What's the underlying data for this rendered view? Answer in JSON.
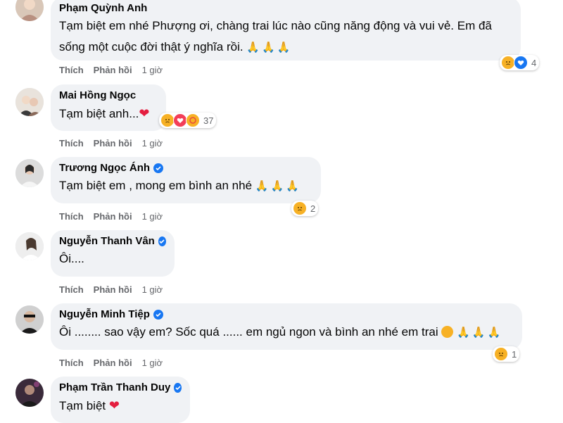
{
  "comments": [
    {
      "name": "Phạm Quỳnh Anh",
      "verified": false,
      "lines": [
        "Tạm biệt em nhé Phượng ơi, chàng trai lúc nào cũng năng động và vui vẻ. Em đã",
        "sống một cuộc đời thật ý nghĩa rồi."
      ],
      "reaction_count": "4",
      "like": "Thích",
      "reply": "Phản hồi",
      "time": "1 giờ"
    },
    {
      "name": "Mai Hồng Ngọc",
      "verified": false,
      "lines": [
        "Tạm biệt anh..."
      ],
      "reaction_count": "37",
      "like": "Thích",
      "reply": "Phản hồi",
      "time": "1 giờ"
    },
    {
      "name": "Trương Ngọc Ánh",
      "verified": true,
      "lines": [
        "Tạm biệt em , mong em bình an nhé"
      ],
      "reaction_count": "2",
      "like": "Thích",
      "reply": "Phản hồi",
      "time": "1 giờ"
    },
    {
      "name": "Nguyễn Thanh Vân",
      "verified": true,
      "lines": [
        "Ôi...."
      ],
      "like": "Thích",
      "reply": "Phản hồi",
      "time": "1 giờ"
    },
    {
      "name": "Nguyễn Minh Tiệp",
      "verified": true,
      "lines": [
        "Ôi ........ sao vậy em? Sốc quá ...... em ngủ ngon và bình an nhé em trai"
      ],
      "reaction_count": "1",
      "like": "Thích",
      "reply": "Phản hồi",
      "time": "1 giờ"
    },
    {
      "name": "Phạm Trần Thanh Duy",
      "verified": true,
      "lines": [
        "Tạm biệt"
      ]
    }
  ],
  "icons": {
    "pray": "folded-hands-emoji",
    "heart": "red-heart-emoji",
    "sad": "sad-face-emoji",
    "verified": "verified-badge-icon"
  },
  "colors": {
    "bubble": "#f0f2f5",
    "action_text": "#65676b",
    "verified": "#1877f2",
    "heart": "#e41e3f",
    "sad_reaction": "#f7b125",
    "love_reaction": "#f33e58"
  }
}
